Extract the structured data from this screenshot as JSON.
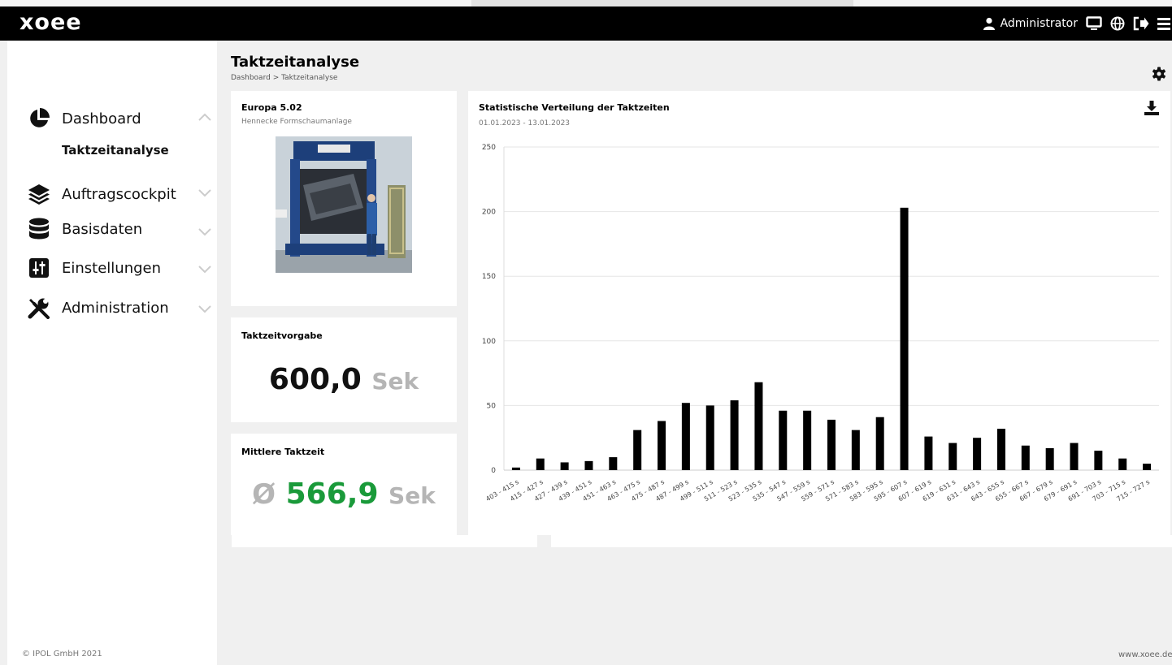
{
  "app": {
    "logo": "xoee"
  },
  "header": {
    "user_label": "Administrator"
  },
  "sidebar": {
    "items": [
      {
        "label": "Dashboard",
        "icon": "pie-chart-icon"
      },
      {
        "label": "Auftragscockpit",
        "icon": "layers-icon"
      },
      {
        "label": "Basisdaten",
        "icon": "database-icon"
      },
      {
        "label": "Einstellungen",
        "icon": "sliders-icon"
      },
      {
        "label": "Administration",
        "icon": "tools-icon"
      }
    ],
    "sub_item": "Taktzeitanalyse",
    "copyright": "© IPOL GmbH 2021"
  },
  "page": {
    "title": "Taktzeitanalyse",
    "breadcrumb": "Dashboard > Taktzeitanalyse"
  },
  "machine_card": {
    "title": "Europa 5.02",
    "subtitle": "Hennecke Formschaumanlage"
  },
  "target_card": {
    "title": "Taktzeitvorgabe",
    "value": "600,0",
    "unit": "Sek"
  },
  "mean_card": {
    "title": "Mittlere Taktzeit",
    "prefix": "Ø",
    "value": "566,9",
    "unit": "Sek",
    "value_color": "#1a9a3a"
  },
  "chart_card": {
    "title": "Statistische Verteilung der Taktzeiten",
    "date_range": "01.01.2023 - 13.01.2023"
  },
  "chart_data": {
    "type": "bar",
    "title": "Statistische Verteilung der Taktzeiten",
    "subtitle": "01.01.2023 - 13.01.2023",
    "xlabel": "",
    "ylabel": "",
    "ylim": [
      0,
      250
    ],
    "yticks": [
      0,
      50,
      100,
      150,
      200,
      250
    ],
    "grid": true,
    "bar_color": "#000000",
    "categories": [
      "403 - 415 s",
      "415 - 427 s",
      "427 - 439 s",
      "439 - 451 s",
      "451 - 463 s",
      "463 - 475 s",
      "475 - 487 s",
      "487 - 499 s",
      "499 - 511 s",
      "511 - 523 s",
      "523 - 535 s",
      "535 - 547 s",
      "547 - 559 s",
      "559 - 571 s",
      "571 - 583 s",
      "583 - 595 s",
      "595 - 607 s",
      "607 - 619 s",
      "619 - 631 s",
      "631 - 643 s",
      "643 - 655 s",
      "655 - 667 s",
      "667 - 679 s",
      "679 - 691 s",
      "691 - 703 s",
      "703 - 715 s",
      "715 - 727 s"
    ],
    "values": [
      2,
      9,
      6,
      7,
      10,
      31,
      38,
      52,
      50,
      54,
      68,
      46,
      46,
      39,
      31,
      41,
      203,
      26,
      21,
      25,
      32,
      19,
      17,
      21,
      15,
      9,
      5
    ]
  },
  "footer": {
    "url": "www.xoee.de"
  }
}
